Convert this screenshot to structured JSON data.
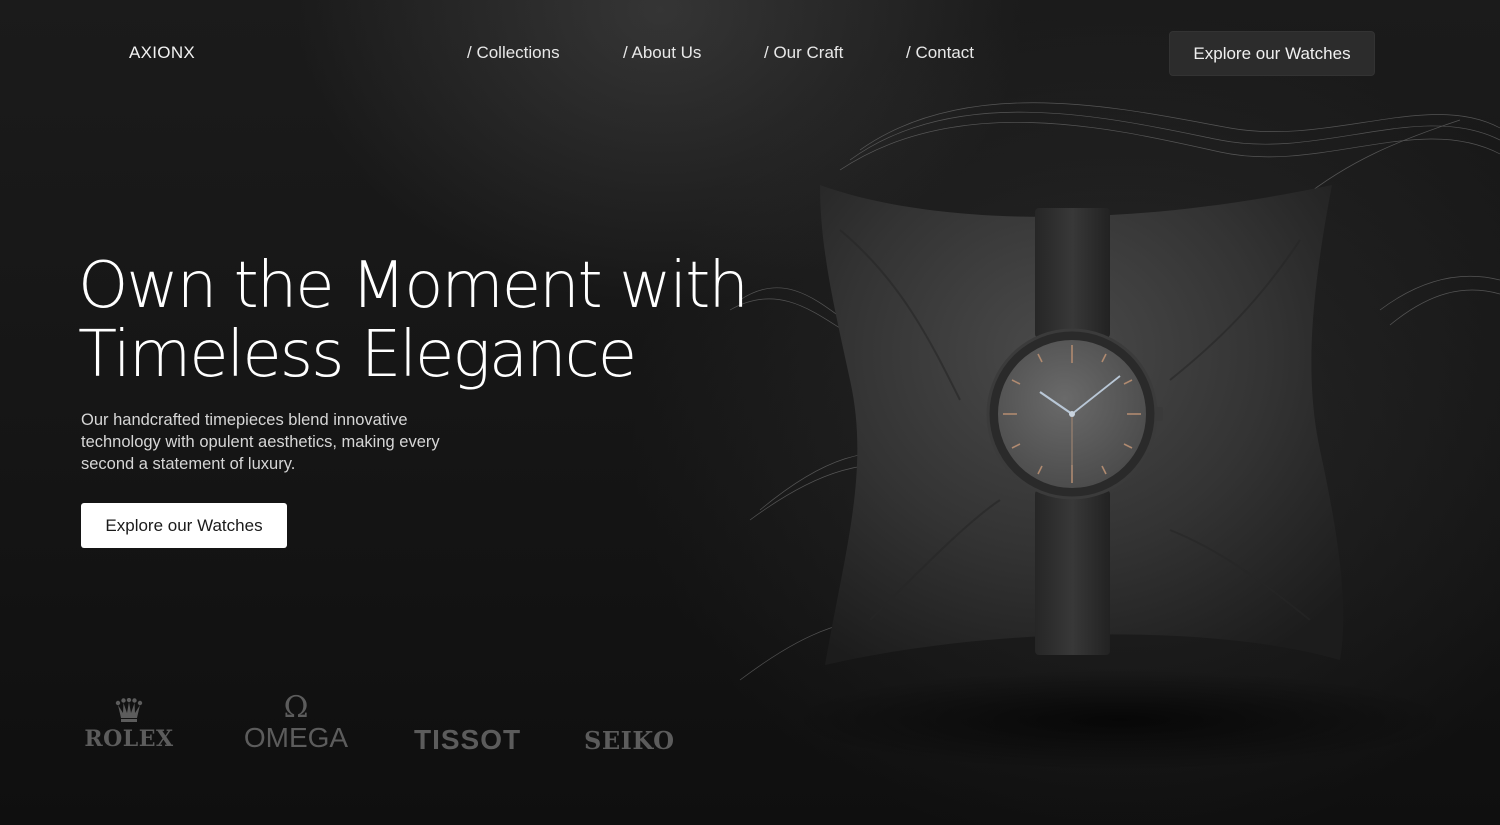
{
  "header": {
    "brand": "AXIONX",
    "nav": [
      "/ Collections",
      "/ About Us",
      "/ Our Craft",
      "/ Contact"
    ],
    "cta": "Explore our Watches"
  },
  "hero": {
    "headline_line1": "Own the Moment with",
    "headline_line2": "Timeless Elegance",
    "subtext": "Our handcrafted timepieces blend innovative technology with opulent aesthetics, making every second a statement of luxury.",
    "cta": "Explore our Watches"
  },
  "brands": {
    "rolex": "ROLEX",
    "omega": "OMEGA",
    "tissot": "TISSOT",
    "seiko": "SEIKO"
  },
  "colors": {
    "background": "#141414",
    "pillow": "#3a3a3a",
    "watch_dial": "#5a5a5a",
    "logo_gray": "#5c5c5c",
    "hand_accent": "#a7b8c8"
  },
  "icons": {
    "rolex_crown": "crown-icon",
    "omega_symbol": "omega-icon"
  }
}
